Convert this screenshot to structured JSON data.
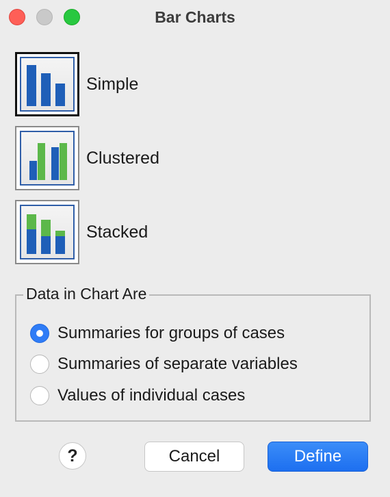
{
  "window": {
    "title": "Bar Charts",
    "traffic_lights": [
      "close",
      "minimize",
      "zoom"
    ]
  },
  "chart_types": [
    {
      "label": "Simple",
      "icon": "simple-bar-chart-icon",
      "selected": true
    },
    {
      "label": "Clustered",
      "icon": "clustered-bar-chart-icon",
      "selected": false
    },
    {
      "label": "Stacked",
      "icon": "stacked-bar-chart-icon",
      "selected": false
    }
  ],
  "data_group": {
    "legend": "Data in Chart Are",
    "options": [
      {
        "label": "Summaries for groups of cases",
        "selected": true
      },
      {
        "label": "Summaries of separate variables",
        "selected": false
      },
      {
        "label": "Values of individual cases",
        "selected": false
      }
    ]
  },
  "buttons": {
    "help": "?",
    "cancel": "Cancel",
    "define": "Define"
  },
  "colors": {
    "bar_blue": "#1f5fb8",
    "bar_green": "#5cb84a",
    "accent": "#2f7cf6"
  }
}
